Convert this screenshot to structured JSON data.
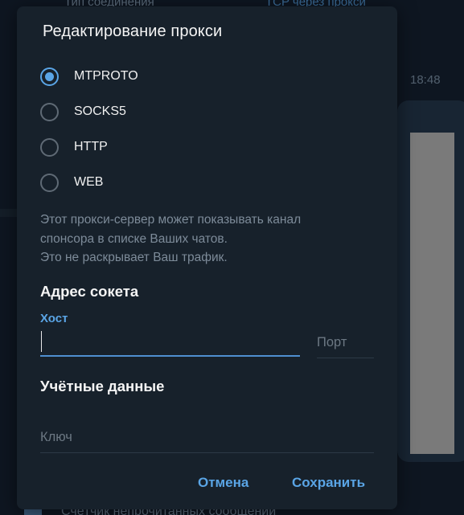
{
  "background": {
    "top_left_text": "Тип соединения",
    "top_right_text": "TCP через прокси",
    "time": "18:48",
    "bottom_text": "Счётчик непрочитанных сообщений"
  },
  "dialog": {
    "title": "Редактирование прокси",
    "proxy_types": [
      {
        "label": "MTPROTO",
        "checked": true
      },
      {
        "label": "SOCKS5",
        "checked": false
      },
      {
        "label": "HTTP",
        "checked": false
      },
      {
        "label": "WEB",
        "checked": false
      }
    ],
    "info_lines": [
      "Этот прокси-сервер может показывать канал",
      "спонсора в списке Ваших чатов.",
      "Это не раскрывает Ваш трафик."
    ],
    "socket_section": "Адрес сокета",
    "host_label": "Хост",
    "host_value": "",
    "port_placeholder": "Порт",
    "credentials_section": "Учётные данные",
    "key_placeholder": "Ключ",
    "cancel_label": "Отмена",
    "save_label": "Сохранить"
  },
  "colors": {
    "accent": "#5aa5e6",
    "dialog_bg": "#17212b",
    "text_primary": "#f0f0f0",
    "text_secondary": "#7d8b99"
  }
}
